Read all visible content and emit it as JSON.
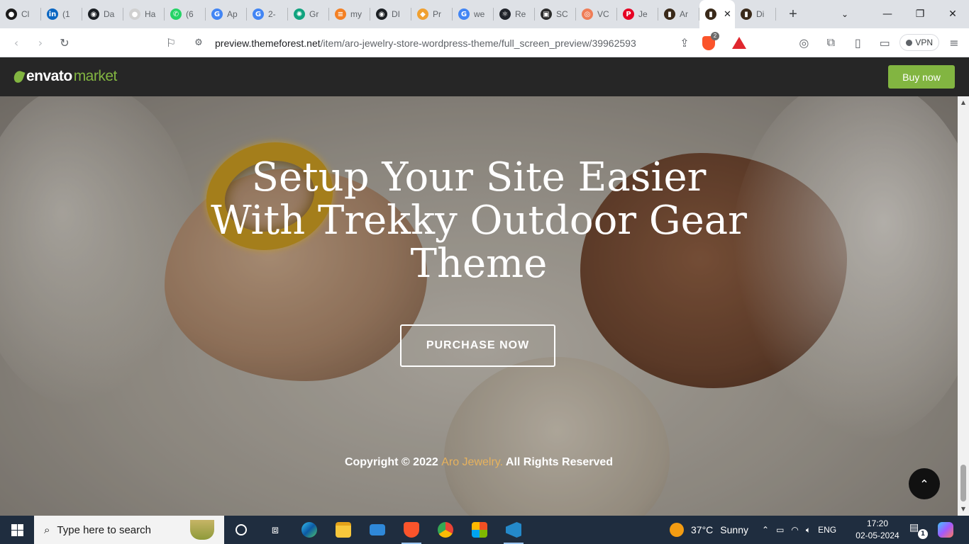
{
  "browser": {
    "tabs": [
      {
        "title": "Cl",
        "icon": "upwork-icon",
        "color": "#1b1b1b",
        "glyph": "●"
      },
      {
        "title": "(1",
        "icon": "linkedin-icon",
        "color": "#0a66c2",
        "glyph": "in"
      },
      {
        "title": "Da",
        "icon": "github-icon",
        "color": "#1b1f23",
        "glyph": "◉"
      },
      {
        "title": "Ha",
        "icon": "chat-bubble-icon",
        "color": "#d0d0d0",
        "glyph": "●"
      },
      {
        "title": "(6",
        "icon": "whatsapp-icon",
        "color": "#25d366",
        "glyph": "✆"
      },
      {
        "title": "Ap",
        "icon": "google-icon",
        "color": "#4285f4",
        "glyph": "G"
      },
      {
        "title": "2-",
        "icon": "google-icon",
        "color": "#4285f4",
        "glyph": "G"
      },
      {
        "title": "Gr",
        "icon": "chatgpt-icon",
        "color": "#10a37f",
        "glyph": "✺"
      },
      {
        "title": "my",
        "icon": "stackoverflow-icon",
        "color": "#f48024",
        "glyph": "≡"
      },
      {
        "title": "DI",
        "icon": "github-icon",
        "color": "#1b1f23",
        "glyph": "◉"
      },
      {
        "title": "Pr",
        "icon": "diamond-icon",
        "color": "#f0a030",
        "glyph": "◆"
      },
      {
        "title": "we",
        "icon": "google-icon",
        "color": "#4285f4",
        "glyph": "G"
      },
      {
        "title": "Re",
        "icon": "react-icon",
        "color": "#20232a",
        "glyph": "⚛"
      },
      {
        "title": "SC",
        "icon": "screen-icon",
        "color": "#2b2b2b",
        "glyph": "▣"
      },
      {
        "title": "VC",
        "icon": "target-icon",
        "color": "#ef7d57",
        "glyph": "◎"
      },
      {
        "title": "Je",
        "icon": "pinterest-icon",
        "color": "#e60023",
        "glyph": "P"
      },
      {
        "title": "Ar",
        "icon": "themeforest-icon",
        "color": "#3a2a1a",
        "glyph": "▮"
      },
      {
        "title": "",
        "icon": "themeforest-icon",
        "color": "#3a2a1a",
        "glyph": "▮",
        "active": true
      },
      {
        "title": "Di",
        "icon": "themeforest-icon",
        "color": "#3a2a1a",
        "glyph": "▮"
      }
    ],
    "url_host": "preview.themeforest.net",
    "url_path": "/item/aro-jewelry-store-wordpress-theme/full_screen_preview/39962593",
    "brave_badge": "2",
    "vpn_label": "VPN"
  },
  "envato": {
    "logo_word1": "envato",
    "logo_word2": "market",
    "buy_now": "Buy now",
    "brand_color": "#82b541"
  },
  "hero": {
    "headline_line1": "Setup Your Site Easier",
    "headline_line2": "With Trekky Outdoor Gear",
    "headline_line3": "Theme",
    "purchase_label": "PURCHASE NOW",
    "copyright_prefix": "Copyright © 2022 ",
    "copyright_brand": "Aro Jewelry.",
    "copyright_suffix": " All Rights Reserved",
    "accent_color": "#e7b25d"
  },
  "taskbar": {
    "search_placeholder": "Type here to search",
    "weather_temp": "37°C",
    "weather_desc": "Sunny",
    "language": "ENG",
    "time": "17:20",
    "date": "02-05-2024",
    "notification_count": "1"
  }
}
